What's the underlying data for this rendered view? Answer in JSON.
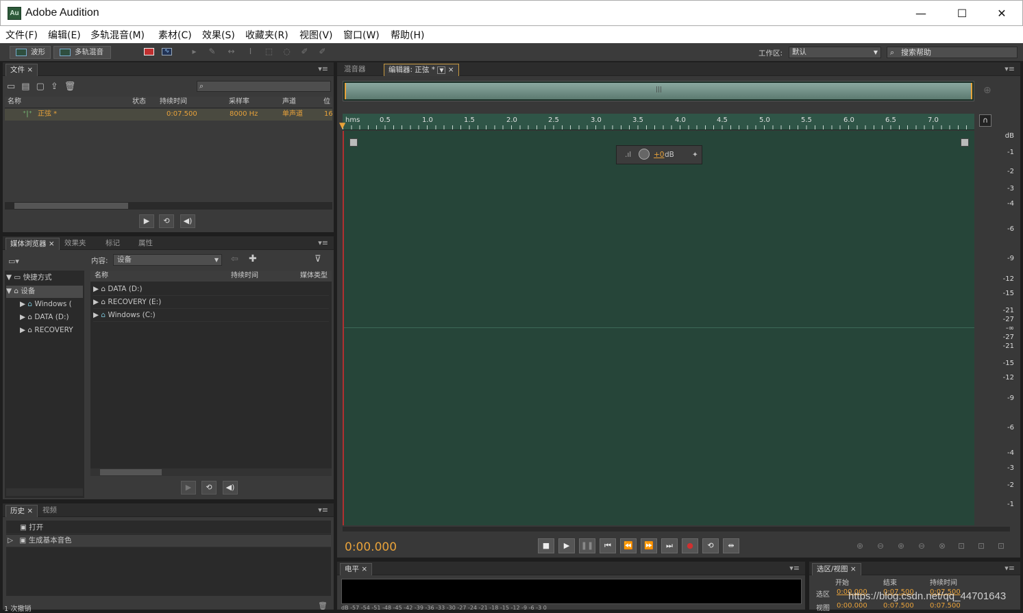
{
  "window": {
    "title": "Adobe Audition",
    "logo": "Au",
    "minimize": "—",
    "maximize": "☐",
    "close": "✕"
  },
  "menu": [
    "文件(F)",
    "编辑(E)",
    "多轨混音(M)",
    "素材(C)",
    "效果(S)",
    "收藏夹(R)",
    "视图(V)",
    "窗口(W)",
    "帮助(H)"
  ],
  "toolbar": {
    "waveform": "波形",
    "multitrack": "多轨混音",
    "workspace_label": "工作区:",
    "workspace_value": "默认",
    "search_placeholder": "搜索帮助"
  },
  "files_panel": {
    "tab": "文件",
    "columns": [
      "名称",
      "状态",
      "持续时间",
      "采样率",
      "声道",
      "位"
    ],
    "rows": [
      {
        "name": "正弦 *",
        "status": "",
        "duration": "0:07.500",
        "samplerate": "8000 Hz",
        "channels": "单声道",
        "bits": "16"
      }
    ]
  },
  "media_panel": {
    "tabs": [
      "媒体浏览器",
      "效果夹",
      "标记",
      "属性"
    ],
    "content_label": "内容:",
    "content_value": "设备",
    "tree": [
      {
        "label": "快捷方式",
        "level": 0
      },
      {
        "label": "设备",
        "level": 0
      },
      {
        "label": "Windows (",
        "level": 1
      },
      {
        "label": "DATA (D:)",
        "level": 1
      },
      {
        "label": "RECOVERY",
        "level": 1
      }
    ],
    "columns": [
      "名称",
      "持续时间",
      "媒体类型"
    ],
    "items": [
      "DATA (D:)",
      "RECOVERY (E:)",
      "Windows (C:)"
    ]
  },
  "history_panel": {
    "tabs": [
      "历史",
      "视频"
    ],
    "items": [
      "打开",
      "生成基本音色"
    ],
    "status": "1 次撤销"
  },
  "editor": {
    "tabs": [
      "混音器",
      "编辑器: 正弦 *"
    ],
    "ruler": [
      "hms",
      "0.5",
      "1.0",
      "1.5",
      "2.0",
      "2.5",
      "3.0",
      "3.5",
      "4.0",
      "4.5",
      "5.0",
      "5.5",
      "6.0",
      "6.5",
      "7.0"
    ],
    "hud_gain": "+0",
    "hud_unit": "dB",
    "db_scale": [
      "dB",
      "-1",
      "-2",
      "-3",
      "-4",
      "-6",
      "-9",
      "-12",
      "-15",
      "-21",
      "-27",
      "-∞",
      "-27",
      "-21",
      "-15",
      "-12",
      "-9",
      "-6",
      "-4",
      "-3",
      "-2",
      "-1"
    ],
    "time": "0:00.000"
  },
  "levels_panel": {
    "tab": "电平",
    "scale": [
      "dB",
      "-57",
      "-54",
      "-51",
      "-48",
      "-45",
      "-42",
      "-39",
      "-36",
      "-33",
      "-30",
      "-27",
      "-24",
      "-21",
      "-18",
      "-15",
      "-12",
      "-9",
      "-6",
      "-3",
      "0"
    ]
  },
  "selection_panel": {
    "tab": "选区/视图",
    "headers": [
      "开始",
      "结束",
      "持续时间"
    ],
    "rows": [
      {
        "label": "选区",
        "start": "0:00.000",
        "end": "0:07.500",
        "dur": "0:07.500"
      },
      {
        "label": "视图",
        "start": "0:00.000",
        "end": "0:07.500",
        "dur": "0:07.500"
      }
    ]
  },
  "watermark": "https://blog.csdn.net/qq_44701643",
  "colors": {
    "waveform_bg": "#264539",
    "accent": "#e8a23a",
    "panel": "#3a3a3a"
  }
}
